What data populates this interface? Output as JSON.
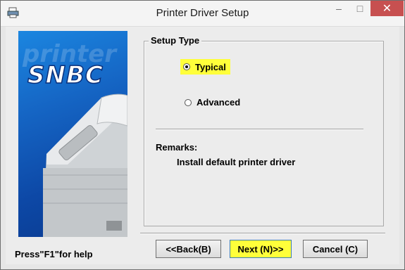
{
  "window": {
    "title": "Printer Driver Setup",
    "controls": {
      "minimize": "–",
      "maximize": "□",
      "close": "✕"
    }
  },
  "banner": {
    "logo_text": "SNBC",
    "watermark_text": "printer"
  },
  "setup_type": {
    "group_title": "Setup Type",
    "options": [
      {
        "label": "Typical",
        "selected": true,
        "highlighted": true
      },
      {
        "label": "Advanced",
        "selected": false
      }
    ]
  },
  "remarks": {
    "label": "Remarks:",
    "text": "Install default printer driver"
  },
  "footer": {
    "help_text": "Press\"F1\"for help",
    "back_label": "<<Back(B)",
    "next_label": "Next (N)>>",
    "cancel_label": "Cancel (C)"
  },
  "colors": {
    "highlight": "#ffff3a",
    "banner_blue": "#1565c4",
    "close_red": "#c75050"
  }
}
